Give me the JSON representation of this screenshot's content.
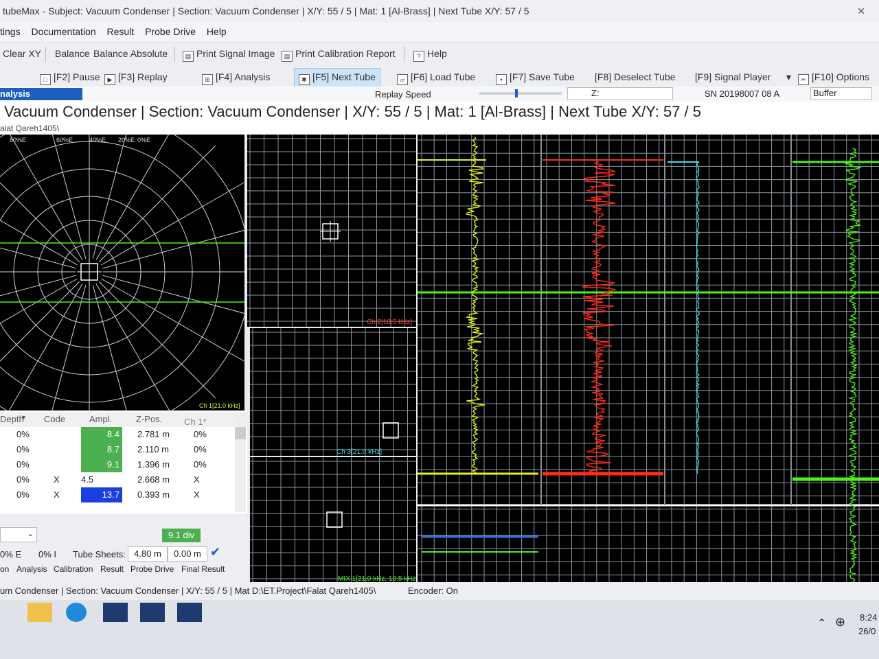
{
  "window": {
    "title": "tubeMax - Subject: Vacuum Condenser | Section: Vacuum Condenser | X/Y: 55 / 5 | Mat: 1 [Al-Brass] | Next Tube X/Y: 57 / 5"
  },
  "menu": [
    "tings",
    "Documentation",
    "Result",
    "Probe Drive",
    "Help"
  ],
  "toolbar1": {
    "clear_xy": "Clear XY",
    "balance": "Balance",
    "balance_absolute": "Balance Absolute",
    "print_signal": "Print Signal Image",
    "print_calibration": "Print Calibration Report",
    "help": "Help"
  },
  "toolbar2": {
    "pause": "[F2] Pause",
    "replay": "[F3] Replay",
    "analysis": "[F4] Analysis",
    "next_tube": "[F5] Next Tube",
    "load_tube": "[F6] Load Tube",
    "save_tube": "[F7] Save Tube",
    "deselect_tube": "[F8] Deselect Tube",
    "signal_player": "[F9] Signal Player",
    "options": "[F10] Options"
  },
  "statusrow": {
    "analysis_tab": "nalysis",
    "replay_speed": "Replay Speed",
    "z_label": "Z:",
    "serial": "SN 20198007 08 A",
    "buffer": "Buffer"
  },
  "headline": "Vacuum Condenser | Section: Vacuum Condenser | X/Y: 55 / 5 | Mat: 1 [Al-Brass] | Next Tube X/Y: 57 / 5",
  "path": "alat Qareh1405\\",
  "lissajous": {
    "scale_labels": [
      "80%E",
      "60%E",
      "40%E",
      "20%E",
      "0%E"
    ],
    "channel": "Ch 1[21.0 kHz]"
  },
  "panels": {
    "ch2": "Ch 2[10.5 kHz]",
    "ch3": "Ch 3[21.0 kHz]",
    "mix": "MIX 1[21.0 kHz, 10.5 kHz]"
  },
  "table": {
    "headers": [
      "Depth",
      "Code",
      "Ampl.",
      "Z-Pos.",
      "Ch 1*"
    ],
    "rows": [
      {
        "depth": "0%",
        "code": "",
        "ampl": "8.4",
        "zpos": "2.781 m",
        "ch1": "0%",
        "style": "g"
      },
      {
        "depth": "0%",
        "code": "",
        "ampl": "8.7",
        "zpos": "2.110 m",
        "ch1": "0%",
        "style": "g"
      },
      {
        "depth": "0%",
        "code": "",
        "ampl": "9.1",
        "zpos": "1.396 m",
        "ch1": "0%",
        "style": "g"
      },
      {
        "depth": "0%",
        "code": "X",
        "ampl": "4.5",
        "zpos": "2.668 m",
        "ch1": "X",
        "style": ""
      },
      {
        "depth": "0%",
        "code": "X",
        "ampl": "13.7",
        "zpos": "0.393 m",
        "ch1": "X",
        "style": "b"
      }
    ]
  },
  "controls": {
    "div": "9.1 div",
    "e_pct": "0% E",
    "i_pct": "0% I",
    "tube_sheets": "Tube Sheets:",
    "ts1": "4.80 m",
    "ts2": "0.00 m",
    "tabs": [
      "on",
      "Analysis",
      "Calibration",
      "Result",
      "Probe Drive",
      "Final Result"
    ]
  },
  "bottom": {
    "status": "um Condenser | Section: Vacuum Condenser | X/Y: 55 / 5 | Mat D:\\ET.Project\\Falat Qareh1405\\",
    "encoder": "Encoder: On"
  },
  "tray": {
    "time": "8:24",
    "date": "26/0"
  },
  "colors": {
    "yellow": "#e6f21a",
    "red": "#ff2a1a",
    "cyan": "#3fd9e6",
    "green": "#4df21a",
    "grid": "#a8b2b8",
    "blue": "#2f6fe0"
  }
}
